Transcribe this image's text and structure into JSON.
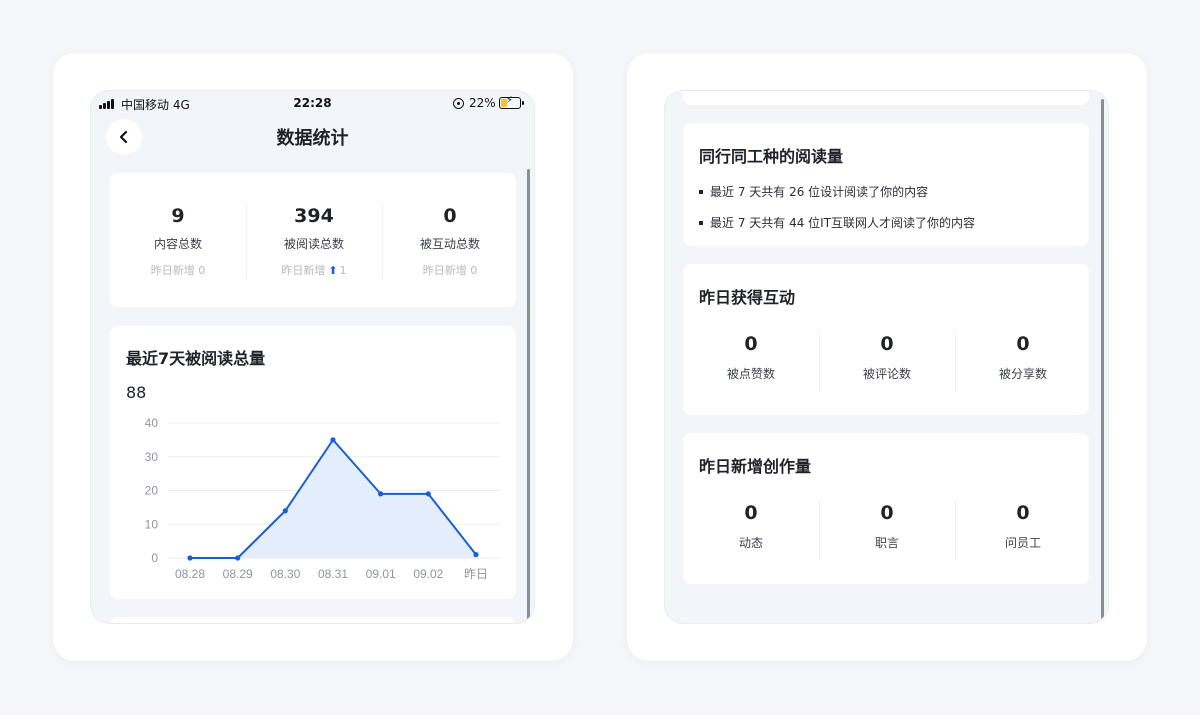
{
  "status_bar": {
    "carrier": "中国移动  4G",
    "time": "22:28",
    "battery": "22%"
  },
  "nav": {
    "title": "数据统计"
  },
  "stats": [
    {
      "value": "9",
      "label": "内容总数",
      "sub": "昨日新增 0",
      "trend": ""
    },
    {
      "value": "394",
      "label": "被阅读总数",
      "sub": "昨日新增",
      "trend": "1"
    },
    {
      "value": "0",
      "label": "被互动总数",
      "sub": "昨日新增 0",
      "trend": ""
    }
  ],
  "chart_section": {
    "title": "最近7天被阅读总量",
    "total": "88"
  },
  "chart_data": {
    "type": "area",
    "title": "",
    "categories": [
      "08.28",
      "08.29",
      "08.30",
      "08.31",
      "09.01",
      "09.02",
      "昨日"
    ],
    "values": [
      0,
      0,
      14,
      35,
      19,
      19,
      1
    ],
    "yticks": [
      0,
      10,
      20,
      30,
      40
    ],
    "ylim": [
      0,
      40
    ],
    "grid": true,
    "line_color": "#1a5fd1",
    "fill_color": "#e3edfb"
  },
  "peer_section": {
    "title": "同行同工种的阅读量",
    "items": [
      "最近 7 天共有 26 位设计阅读了你的内容",
      "最近 7 天共有 44 位IT互联网人才阅读了你的内容"
    ]
  },
  "interaction_section": {
    "title": "昨日获得互动",
    "items": [
      {
        "value": "0",
        "label": "被点赞数"
      },
      {
        "value": "0",
        "label": "被评论数"
      },
      {
        "value": "0",
        "label": "被分享数"
      }
    ]
  },
  "creation_section": {
    "title": "昨日新增创作量",
    "items": [
      {
        "value": "0",
        "label": "动态"
      },
      {
        "value": "0",
        "label": "职言"
      },
      {
        "value": "0",
        "label": "问员工"
      }
    ]
  },
  "icons": {
    "back": "chevron-left-icon",
    "signal": "signal-icon",
    "battery": "battery-charging-icon",
    "lock": "orientation-lock-icon",
    "trend": "arrow-up-icon"
  },
  "colors": {
    "accent": "#1a5fd1",
    "background": "#f2f5f9"
  }
}
